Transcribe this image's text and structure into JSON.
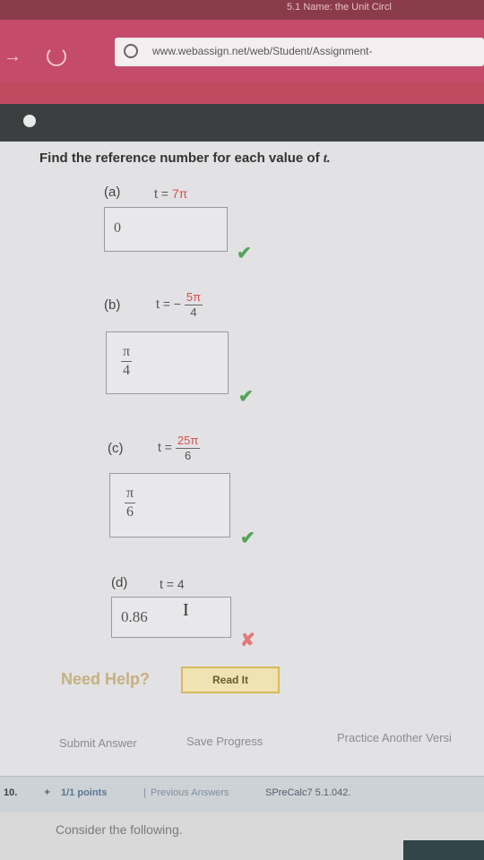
{
  "browser": {
    "tab_text": "5.1 Name: the Unit Circl",
    "url": "www.webassign.net/web/Student/Assignment-"
  },
  "question": {
    "prompt_text": "Find the reference number for each value of",
    "prompt_var": "t.",
    "parts": [
      {
        "label": "(a)",
        "eq_prefix": "t = ",
        "eq_value": "7π",
        "answer": "0",
        "status": "correct"
      },
      {
        "label": "(b)",
        "eq_prefix": "t = −",
        "eq_num": "5π",
        "eq_den": "4",
        "answer_num": "π",
        "answer_den": "4",
        "status": "correct"
      },
      {
        "label": "(c)",
        "eq_prefix": "t = ",
        "eq_num": "25π",
        "eq_den": "6",
        "answer_num": "π",
        "answer_den": "6",
        "status": "correct"
      },
      {
        "label": "(d)",
        "eq_prefix": "t = 4",
        "answer": "0.86",
        "status": "incorrect"
      }
    ]
  },
  "help": {
    "text": "Need Help?",
    "read_button": "Read It"
  },
  "form": {
    "submit": "Submit Answer",
    "save": "Save Progress",
    "practice": "Practice Another Versi"
  },
  "footer": {
    "question_number": "10.",
    "points": "1/1 points",
    "separator": "|",
    "previous_answers": "Previous Answers",
    "code": "SPreCalc7 5.1.042."
  },
  "next_question_text": "Consider the following.",
  "colors": {
    "correct": "#56a35a",
    "incorrect": "#e27a7a",
    "accent": "#d84d4d"
  }
}
